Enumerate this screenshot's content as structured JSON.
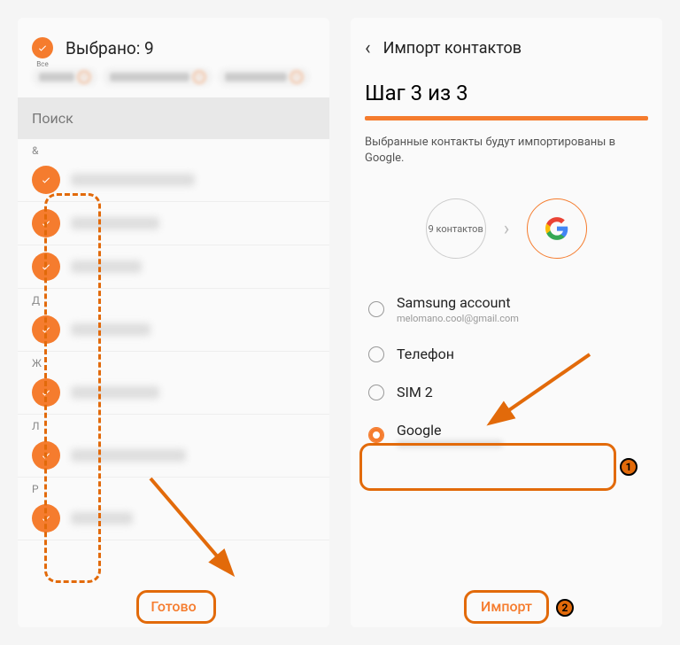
{
  "left": {
    "all_label": "Все",
    "selected_title": "Выбрано: 9",
    "search_placeholder": "Поиск",
    "section_letters": [
      "&",
      "Д",
      "Ж",
      "Л",
      "Р"
    ],
    "done": "Готово"
  },
  "right": {
    "header_title": "Импорт контактов",
    "step_title": "Шаг 3 из 3",
    "desc": "Выбранные контакты будут импортированы в Google.",
    "count_label": "9 контактов",
    "accounts": [
      {
        "label": "Samsung account",
        "sub": "melomano.cool@gmail.com",
        "selected": false
      },
      {
        "label": "Телефон",
        "sub": "",
        "selected": false
      },
      {
        "label": "SIM 2",
        "sub": "",
        "selected": false
      },
      {
        "label": "Google",
        "sub": "",
        "selected": true
      }
    ],
    "import": "Импорт"
  },
  "colors": {
    "accent": "#f57c2e"
  }
}
